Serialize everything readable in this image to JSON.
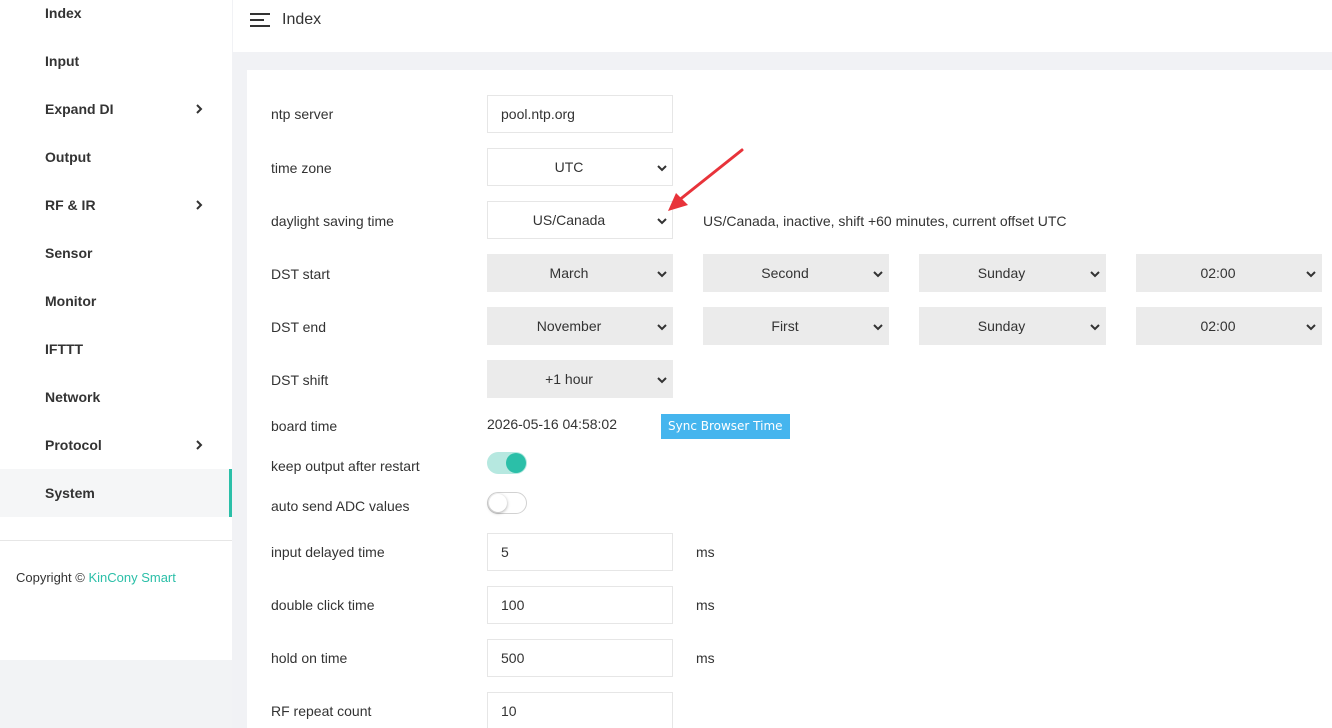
{
  "sidebar": {
    "items": [
      {
        "label": "Index",
        "has_children": false
      },
      {
        "label": "Input",
        "has_children": false
      },
      {
        "label": "Expand DI",
        "has_children": true
      },
      {
        "label": "Output",
        "has_children": false
      },
      {
        "label": "RF & IR",
        "has_children": true
      },
      {
        "label": "Sensor",
        "has_children": false
      },
      {
        "label": "Monitor",
        "has_children": false
      },
      {
        "label": "IFTTT",
        "has_children": false
      },
      {
        "label": "Network",
        "has_children": false
      },
      {
        "label": "Protocol",
        "has_children": true
      },
      {
        "label": "System",
        "has_children": false,
        "active": true
      }
    ],
    "copyright_prefix": "Copyright © ",
    "copyright_brand": "KinCony Smart"
  },
  "header": {
    "title": "Index",
    "menu_icon": "hamburger-menu-icon"
  },
  "form": {
    "ntp_server": {
      "label": "ntp server",
      "value": "pool.ntp.org"
    },
    "time_zone": {
      "label": "time zone",
      "value": "UTC"
    },
    "dst": {
      "label": "daylight saving time",
      "value": "US/Canada",
      "info": "US/Canada, inactive, shift +60 minutes, current offset UTC"
    },
    "dst_start": {
      "label": "DST start",
      "month": "March",
      "week": "Second",
      "day": "Sunday",
      "time": "02:00"
    },
    "dst_end": {
      "label": "DST end",
      "month": "November",
      "week": "First",
      "day": "Sunday",
      "time": "02:00"
    },
    "dst_shift": {
      "label": "DST shift",
      "value": "+1 hour"
    },
    "board_time": {
      "label": "board time",
      "value": "2026-05-16 04:58:02",
      "sync_button": "Sync Browser Time"
    },
    "keep_output": {
      "label": "keep output after restart",
      "enabled": true
    },
    "auto_send_adc": {
      "label": "auto send ADC values",
      "enabled": false
    },
    "input_delayed": {
      "label": "input delayed time",
      "value": "5",
      "unit": "ms"
    },
    "double_click": {
      "label": "double click time",
      "value": "100",
      "unit": "ms"
    },
    "hold_on": {
      "label": "hold on time",
      "value": "500",
      "unit": "ms"
    },
    "rf_repeat": {
      "label": "RF repeat count",
      "value": "10"
    }
  },
  "colors": {
    "accent": "#2bbfa8",
    "sync_button": "#45b5ee",
    "annotation_arrow": "#e8333a"
  }
}
